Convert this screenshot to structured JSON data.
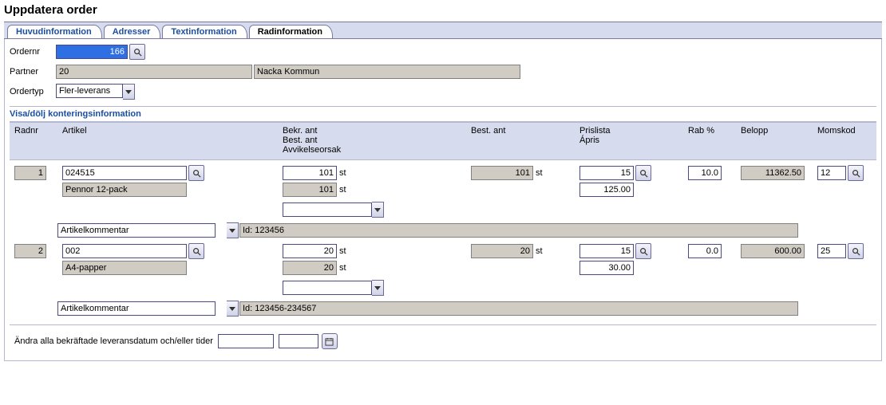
{
  "title": "Uppdatera order",
  "tabs": [
    "Huvudinformation",
    "Adresser",
    "Textinformation",
    "Radinformation"
  ],
  "activeTab": 3,
  "order": {
    "nr_label": "Ordernr",
    "nr": "166",
    "partner_label": "Partner",
    "partner_code": "20",
    "partner_name": "Nacka Kommun",
    "type_label": "Ordertyp",
    "type_value": "Fler-leverans"
  },
  "subhead": "Visa/dölj konteringsinformation",
  "cols": {
    "radnr": "Radnr",
    "artikel": "Artikel",
    "bekr": "Bekr. ant\nBest. ant\nAvvikelseorsak",
    "best": "Best. ant",
    "pris": "Prislista\nÁpris",
    "rab": "Rab %",
    "belopp": "Belopp",
    "moms": "Momskod"
  },
  "lines": [
    {
      "radnr": "1",
      "artikel_code": "024515",
      "artikel_name": "Pennor 12-pack",
      "bekr_ant": "101",
      "best_ant2": "101",
      "unit": "st",
      "best_ant": "101",
      "prislista": "15",
      "apris": "125.00",
      "rab": "10.0",
      "belopp": "11362.50",
      "moms": "12",
      "comment_label": "Artikelkommentar",
      "comment_value": "Id: 123456"
    },
    {
      "radnr": "2",
      "artikel_code": "002",
      "artikel_name": "A4-papper",
      "bekr_ant": "20",
      "best_ant2": "20",
      "unit": "st",
      "best_ant": "20",
      "prislista": "15",
      "apris": "30.00",
      "rab": "0.0",
      "belopp": "600.00",
      "moms": "25",
      "comment_label": "Artikelkommentar",
      "comment_value": "Id: 123456-234567"
    }
  ],
  "footer": {
    "label": "Ändra alla bekräftade leveransdatum och/eller tider",
    "date": "",
    "time": ""
  }
}
